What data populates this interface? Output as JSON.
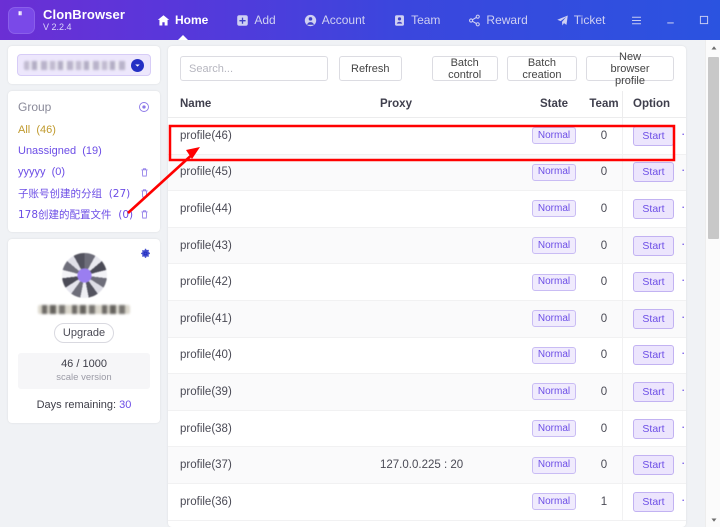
{
  "window": {
    "brand_name": "ClonBrowser",
    "version": "V 2.2.4",
    "logo_icon": "clonbrowser-logo-icon",
    "nav": [
      {
        "label": "Home",
        "icon": "home-icon",
        "active": true
      },
      {
        "label": "Add",
        "icon": "plus-square-icon",
        "active": false
      },
      {
        "label": "Account",
        "icon": "user-circle-icon",
        "active": false
      },
      {
        "label": "Team",
        "icon": "id-card-icon",
        "active": false
      },
      {
        "label": "Reward",
        "icon": "share-icon",
        "active": false
      },
      {
        "label": "Ticket",
        "icon": "paper-plane-icon",
        "active": false
      }
    ],
    "controls": [
      {
        "name": "menu-button",
        "icon": "hamburger-icon"
      },
      {
        "name": "minimize-button",
        "icon": "minimize-icon"
      },
      {
        "name": "maximize-button",
        "icon": "maximize-icon"
      },
      {
        "name": "close-button",
        "icon": "close-icon"
      }
    ]
  },
  "sidebar": {
    "account_selector": {
      "value": "",
      "chevron_icon": "chevron-down-circle-icon"
    },
    "group": {
      "title": "Group",
      "settings_icon": "group-settings-icon",
      "items": [
        {
          "label": "All",
          "count": "(46)",
          "deletable": false,
          "style": "all"
        },
        {
          "label": "Unassigned",
          "count": "(19)",
          "deletable": false,
          "style": "link"
        },
        {
          "label": "yyyyy",
          "count": "(0)",
          "deletable": true,
          "style": "link"
        },
        {
          "label": "子账号创建的分组",
          "count": "(27)",
          "deletable": true,
          "style": "cjk"
        },
        {
          "label": "178创建的配置文件",
          "count": "(0)",
          "deletable": true,
          "style": "cjk"
        }
      ]
    },
    "user": {
      "settings_icon": "user-settings-icon",
      "avatar_icon": "user-avatar",
      "username": "",
      "upgrade_label": "Upgrade",
      "quota_main": "46 / 1000",
      "quota_sub": "scale version",
      "days_label": "Days remaining:",
      "days_value": "30"
    }
  },
  "toolbar": {
    "search_placeholder": "Search...",
    "search_value": "",
    "refresh_label": "Refresh",
    "batch_control_label": "Batch control",
    "batch_creation_label": "Batch creation",
    "new_profile_label": "New browser profile"
  },
  "table": {
    "columns": {
      "name": "Name",
      "proxy": "Proxy",
      "state": "State",
      "team": "Team",
      "option": "Option"
    },
    "start_label": "Start",
    "more_label": "···",
    "rows": [
      {
        "name": "profile(46)",
        "proxy": "",
        "state": "Normal",
        "team": "0"
      },
      {
        "name": "profile(45)",
        "proxy": "",
        "state": "Normal",
        "team": "0"
      },
      {
        "name": "profile(44)",
        "proxy": "",
        "state": "Normal",
        "team": "0"
      },
      {
        "name": "profile(43)",
        "proxy": "",
        "state": "Normal",
        "team": "0"
      },
      {
        "name": "profile(42)",
        "proxy": "",
        "state": "Normal",
        "team": "0"
      },
      {
        "name": "profile(41)",
        "proxy": "",
        "state": "Normal",
        "team": "0"
      },
      {
        "name": "profile(40)",
        "proxy": "",
        "state": "Normal",
        "team": "0"
      },
      {
        "name": "profile(39)",
        "proxy": "",
        "state": "Normal",
        "team": "0"
      },
      {
        "name": "profile(38)",
        "proxy": "",
        "state": "Normal",
        "team": "0"
      },
      {
        "name": "profile(37)",
        "proxy": "127.0.0.225 : 20",
        "state": "Normal",
        "team": "0"
      },
      {
        "name": "profile(36)",
        "proxy": "",
        "state": "Normal",
        "team": "1"
      }
    ]
  },
  "annotation": {
    "highlight_color": "#ff0000",
    "highlight_target": "profile(46)",
    "arrow_from": "178创建的配置文件 (0)",
    "arrow_to": "profile(46)"
  },
  "colors": {
    "accent_purple": "#6c4de6",
    "header_left": "#6b2fd4",
    "header_right": "#2b53e0",
    "annotation_red": "#ff0000"
  }
}
